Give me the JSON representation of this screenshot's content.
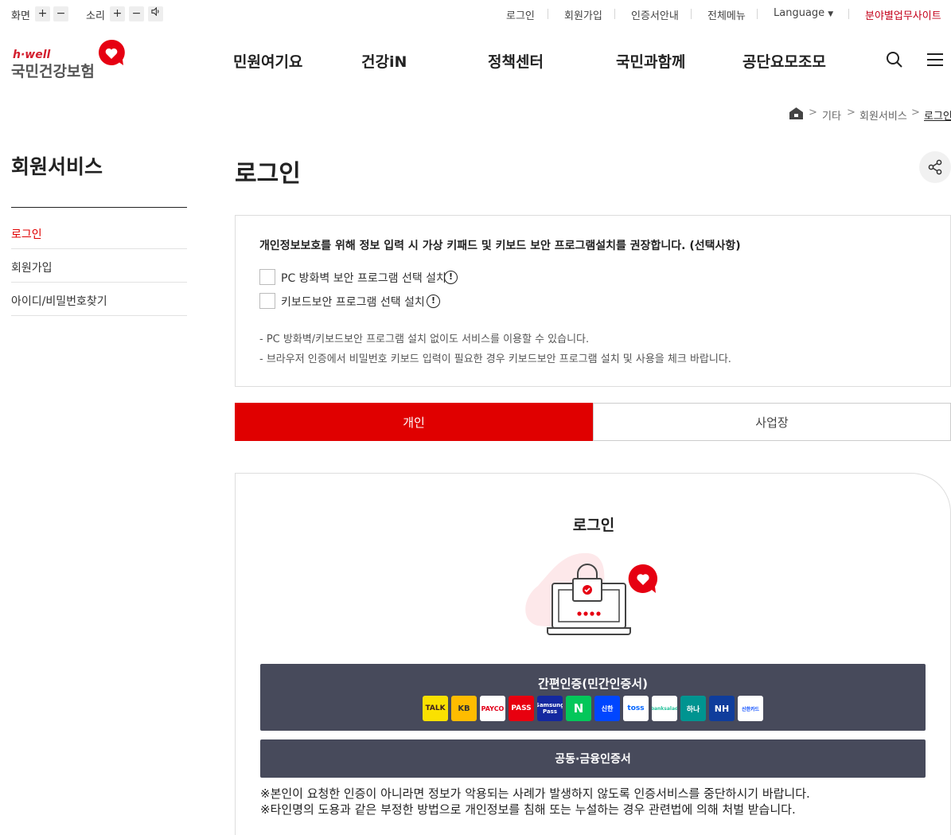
{
  "utility": {
    "screen_label": "화면",
    "sound_label": "소리",
    "links": [
      "로그인",
      "회원가입",
      "인증서안내",
      "전체메뉴",
      "Language",
      "분야별업무사이트"
    ]
  },
  "logo": {
    "tagline": "h·well",
    "name": "국민건강보험"
  },
  "nav": [
    "민원여기요",
    "건강iN",
    "정책센터",
    "국민과함께",
    "공단요모조모"
  ],
  "breadcrumb": [
    "기타",
    "회원서비스",
    "로그인"
  ],
  "sidebar": {
    "title": "회원서비스",
    "items": [
      "로그인",
      "회원가입",
      "아이디/비밀번호찾기"
    ]
  },
  "main": {
    "title": "로그인",
    "notice": {
      "heading": "개인정보보호를 위해 정보 입력 시 가상 키패드 및 키보드 보안 프로그램설치를 권장합니다. (선택사항)",
      "options": [
        "PC 방화벽 보안 프로그램 선택 설치",
        "키보드보안 프로그램 선택 설치"
      ],
      "notes": [
        "- PC 방화벽/키보드보안 프로그램 설치 없이도 서비스를 이용할 수 있습니다.",
        "- 브라우저 인증에서 비밀번호 키보드 입력이 필요한 경우 키보드보안 프로그램 설치 및 사용을 체크 바랍니다."
      ]
    },
    "tabs": [
      "개인",
      "사업장"
    ],
    "login": {
      "title": "로그인",
      "simple_auth": "간편인증(민간인증서)",
      "cert_auth": "공동·금융인증서",
      "providers": [
        "TALK",
        "KB",
        "PAYCO",
        "PASS",
        "Samsung Pass",
        "N",
        "신한",
        "toss",
        "banksalad",
        "하나",
        "NH",
        "신한카드"
      ],
      "warnings": [
        "※본인이 요청한 인증이 아니라면 정보가 악용되는 사례가 발생하지 않도록 인증서비스를 중단하시기 바랍니다.",
        "※타인명의 도용과 같은 부정한 방법으로 개인정보를 침해 또는 누설하는 경우 관련법에 의해 처벌 받습니다."
      ]
    }
  },
  "colors": {
    "accent": "#e00000",
    "dark_button": "#474a5b"
  }
}
